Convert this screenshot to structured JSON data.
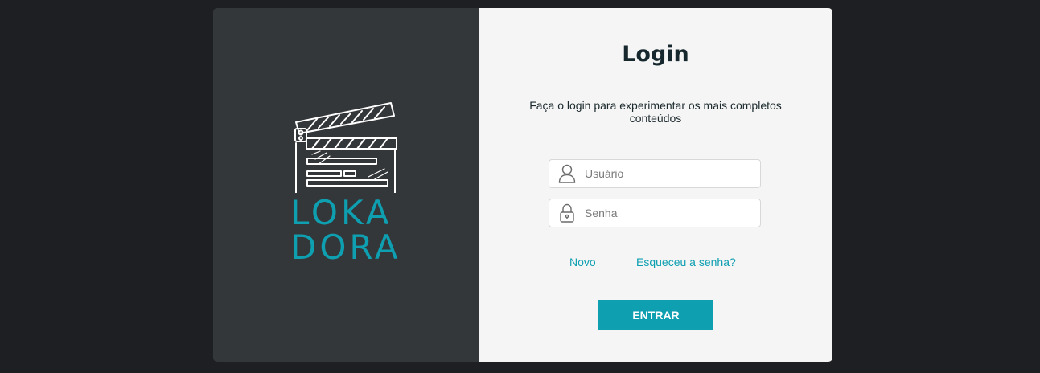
{
  "brand": {
    "line1": "LOKA",
    "line2": "DORA",
    "accent_color": "#0e9fb1",
    "logo_icon": "clapperboard-icon"
  },
  "login": {
    "title": "Login",
    "subtitle": "Faça o login para experimentar os mais completos conteúdos",
    "username": {
      "placeholder": "Usuário",
      "value": "",
      "icon": "user-icon"
    },
    "password": {
      "placeholder": "Senha",
      "value": "",
      "icon": "lock-icon"
    },
    "links": {
      "new_label": "Novo",
      "forgot_label": "Esqueceu a senha?"
    },
    "submit_label": "ENTRAR"
  },
  "colors": {
    "page_bg": "#1d1f23",
    "left_panel": "#343739",
    "right_panel": "#f5f5f5",
    "title": "#16282d"
  }
}
